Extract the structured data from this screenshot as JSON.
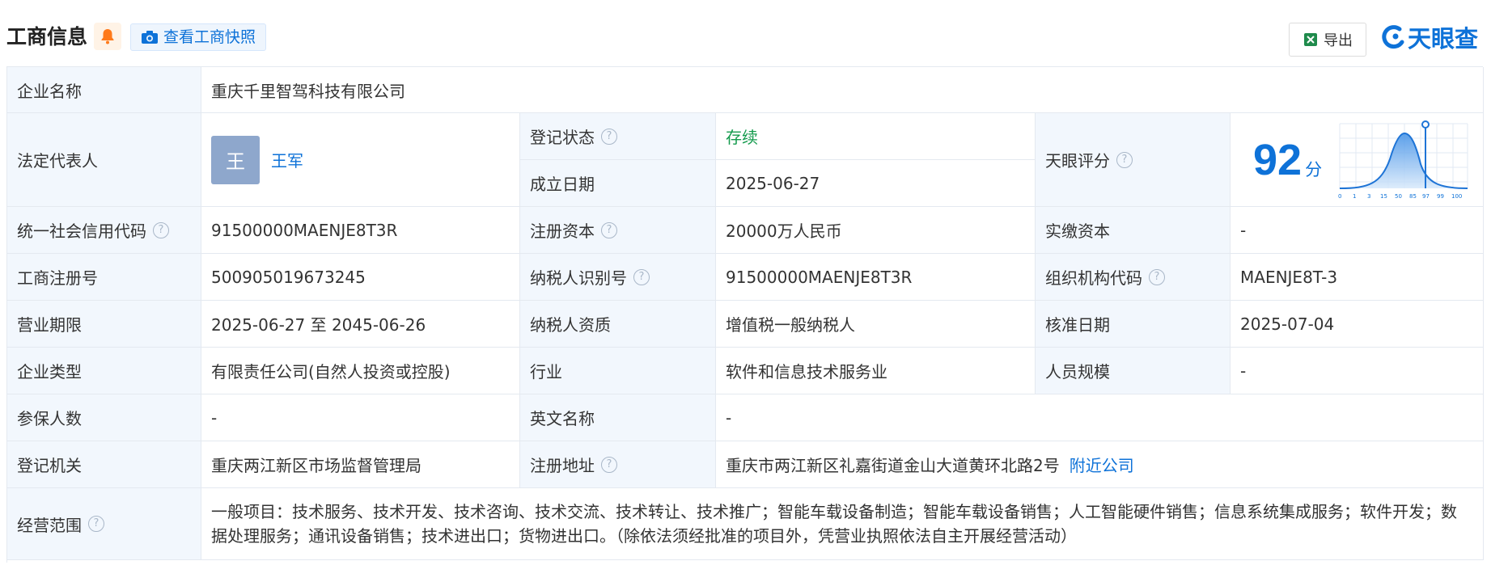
{
  "header": {
    "title": "工商信息",
    "snapshot_label": "查看工商快照",
    "export_label": "导出",
    "logo_text": "天眼查"
  },
  "rows": {
    "company_name": {
      "label": "企业名称",
      "value": "重庆千里智驾科技有限公司"
    },
    "legal_rep": {
      "label": "法定代表人",
      "avatar": "王",
      "name": "王军"
    },
    "reg_status": {
      "label": "登记状态",
      "value": "存续"
    },
    "found_date": {
      "label": "成立日期",
      "value": "2025-06-27"
    },
    "tianyan_score": {
      "label": "天眼评分",
      "value": "92",
      "unit": "分",
      "ticks": [
        "0",
        "1",
        "3",
        "15",
        "50",
        "85",
        "97",
        "99",
        "100"
      ]
    },
    "credit_code": {
      "label": "统一社会信用代码",
      "value": "91500000MAENJE8T3R"
    },
    "reg_capital": {
      "label": "注册资本",
      "value": "20000万人民币"
    },
    "paid_capital": {
      "label": "实缴资本",
      "value": "-"
    },
    "reg_number": {
      "label": "工商注册号",
      "value": "500905019673245"
    },
    "taxpayer_id": {
      "label": "纳税人识别号",
      "value": "91500000MAENJE8T3R"
    },
    "org_code": {
      "label": "组织机构代码",
      "value": "MAENJE8T-3"
    },
    "business_term": {
      "label": "营业期限",
      "value": "2025-06-27 至 2045-06-26"
    },
    "taxpayer_quality": {
      "label": "纳税人资质",
      "value": "增值税一般纳税人"
    },
    "approval_date": {
      "label": "核准日期",
      "value": "2025-07-04"
    },
    "company_type": {
      "label": "企业类型",
      "value": "有限责任公司(自然人投资或控股)"
    },
    "industry": {
      "label": "行业",
      "value": "软件和信息技术服务业"
    },
    "staff_size": {
      "label": "人员规模",
      "value": "-"
    },
    "insured_count": {
      "label": "参保人数",
      "value": "-"
    },
    "english_name": {
      "label": "英文名称",
      "value": "-"
    },
    "reg_authority": {
      "label": "登记机关",
      "value": "重庆两江新区市场监督管理局"
    },
    "reg_address": {
      "label": "注册地址",
      "value": "重庆市两江新区礼嘉街道金山大道黄环北路2号",
      "nearby": "附近公司"
    },
    "business_scope": {
      "label": "经营范围",
      "value": "一般项目：技术服务、技术开发、技术咨询、技术交流、技术转让、技术推广；智能车载设备制造；智能车载设备销售；人工智能硬件销售；信息系统集成服务；软件开发；数据处理服务；通讯设备销售；技术进出口；货物进出口。（除依法须经批准的项目外，凭营业执照依法自主开展经营活动）"
    }
  },
  "colors": {
    "accent": "#0e72d8",
    "status_green": "#159b4e",
    "label_bg": "#f2f7fd"
  }
}
